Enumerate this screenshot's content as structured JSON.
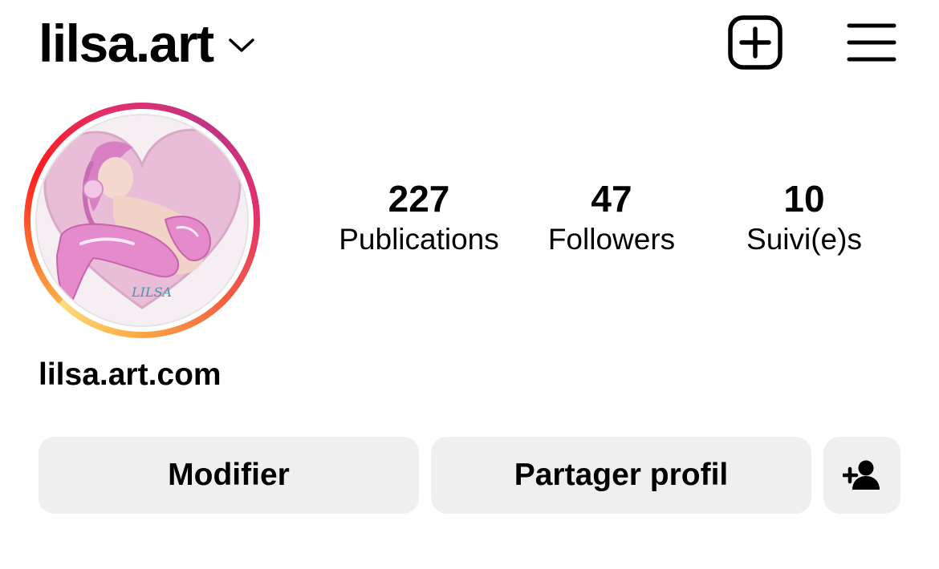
{
  "header": {
    "username": "lilsa.art",
    "icons": {
      "dropdown": "chevron-down-icon",
      "new_post": "plus-square-icon",
      "menu": "hamburger-menu-icon"
    }
  },
  "profile": {
    "avatar_artist_signature": "LILSA",
    "story_ring_colors": [
      "#fcaf45",
      "#fd1d1d",
      "#e1306c",
      "#c13584",
      "#f56040"
    ],
    "stats": [
      {
        "value": "227",
        "label": "Publications"
      },
      {
        "value": "47",
        "label": "Followers"
      },
      {
        "value": "10",
        "label": "Suivi(e)s"
      }
    ],
    "website": "lilsa.art.com"
  },
  "actions": {
    "edit_label": "Modifier",
    "share_label": "Partager profil",
    "add_user_icon": "person-add-icon",
    "button_bg": "#efefef"
  }
}
